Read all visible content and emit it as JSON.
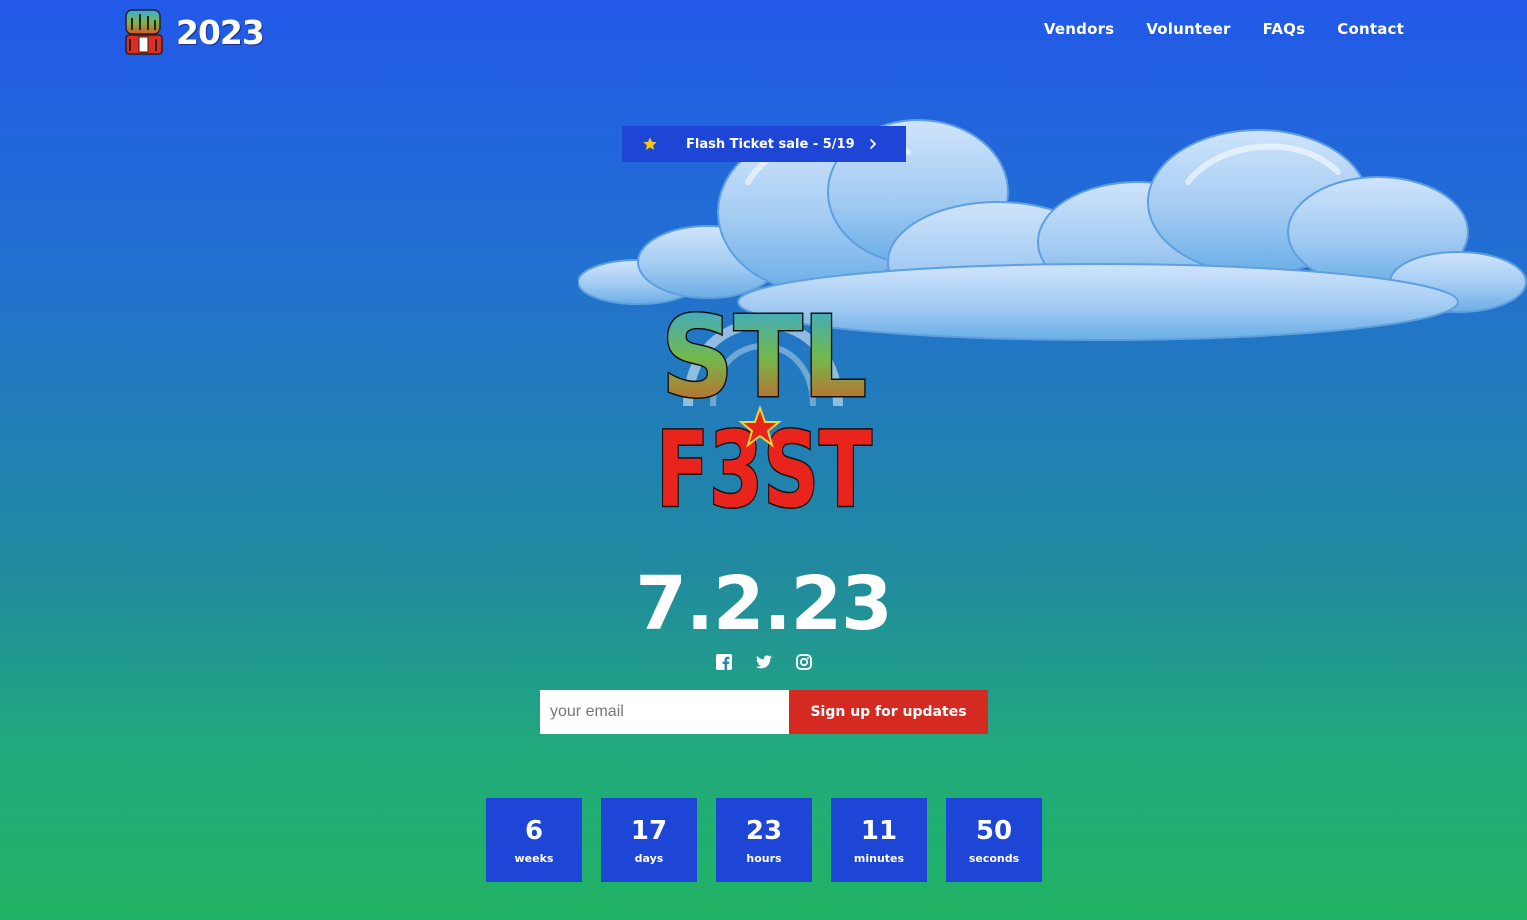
{
  "header": {
    "brand_year": "2023",
    "nav": [
      "Vendors",
      "Volunteer",
      "FAQs",
      "Contact"
    ]
  },
  "promo": {
    "text": "Flash Ticket sale - 5/19",
    "star_icon": "star-icon",
    "chevron_icon": "chevron-right-icon"
  },
  "logo": {
    "line1": "STL",
    "line2": "F3ST"
  },
  "event": {
    "date": "7.2.23"
  },
  "social": [
    "facebook-icon",
    "twitter-icon",
    "instagram-icon"
  ],
  "signup": {
    "placeholder": "your email",
    "button_label": "Sign up for updates"
  },
  "countdown": [
    {
      "value": "6",
      "label": "weeks"
    },
    {
      "value": "17",
      "label": "days"
    },
    {
      "value": "23",
      "label": "hours"
    },
    {
      "value": "11",
      "label": "minutes"
    },
    {
      "value": "50",
      "label": "seconds"
    }
  ],
  "colors": {
    "bg_top": "#2259e8",
    "bg_bottom": "#20b263",
    "box_blue": "#1e46d6",
    "button_red": "#d42a21",
    "star_yellow": "#f5c518"
  }
}
